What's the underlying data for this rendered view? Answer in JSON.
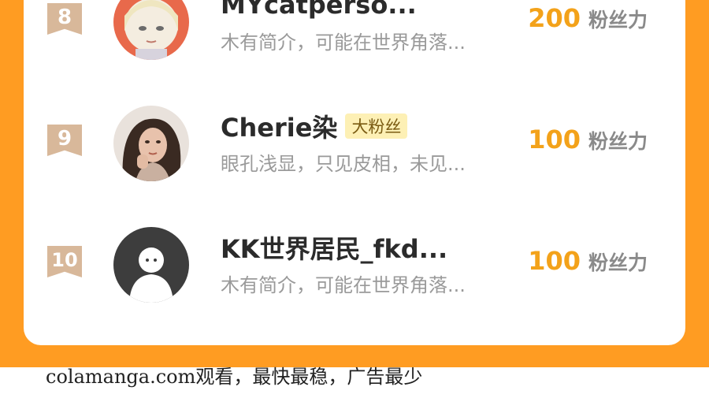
{
  "leaderboard": {
    "rows": [
      {
        "rank": "8",
        "name": "MYcatperso...",
        "badge": "",
        "bio": "木有简介，可能在世界角落...",
        "score": "200",
        "unit": "粉丝力"
      },
      {
        "rank": "9",
        "name": "Cherie染",
        "badge": "大粉丝",
        "bio": "眼孔浅显，只见皮相，未见...",
        "score": "100",
        "unit": "粉丝力"
      },
      {
        "rank": "10",
        "name": "KK世界居民_fkd...",
        "badge": "",
        "bio": "木有简介，可能在世界角落...",
        "score": "100",
        "unit": "粉丝力"
      }
    ]
  },
  "footer": {
    "text": "colamanga.com观看，最快最稳，广告最少"
  },
  "colors": {
    "background_orange": "#ff9c22",
    "score_orange": "#f3a21a",
    "rank_badge": "#d8b89a",
    "fan_badge_bg": "#fdf0b5"
  },
  "icons": [
    "anime-avatar-icon",
    "photo-avatar-icon",
    "default-avatar-icon"
  ]
}
